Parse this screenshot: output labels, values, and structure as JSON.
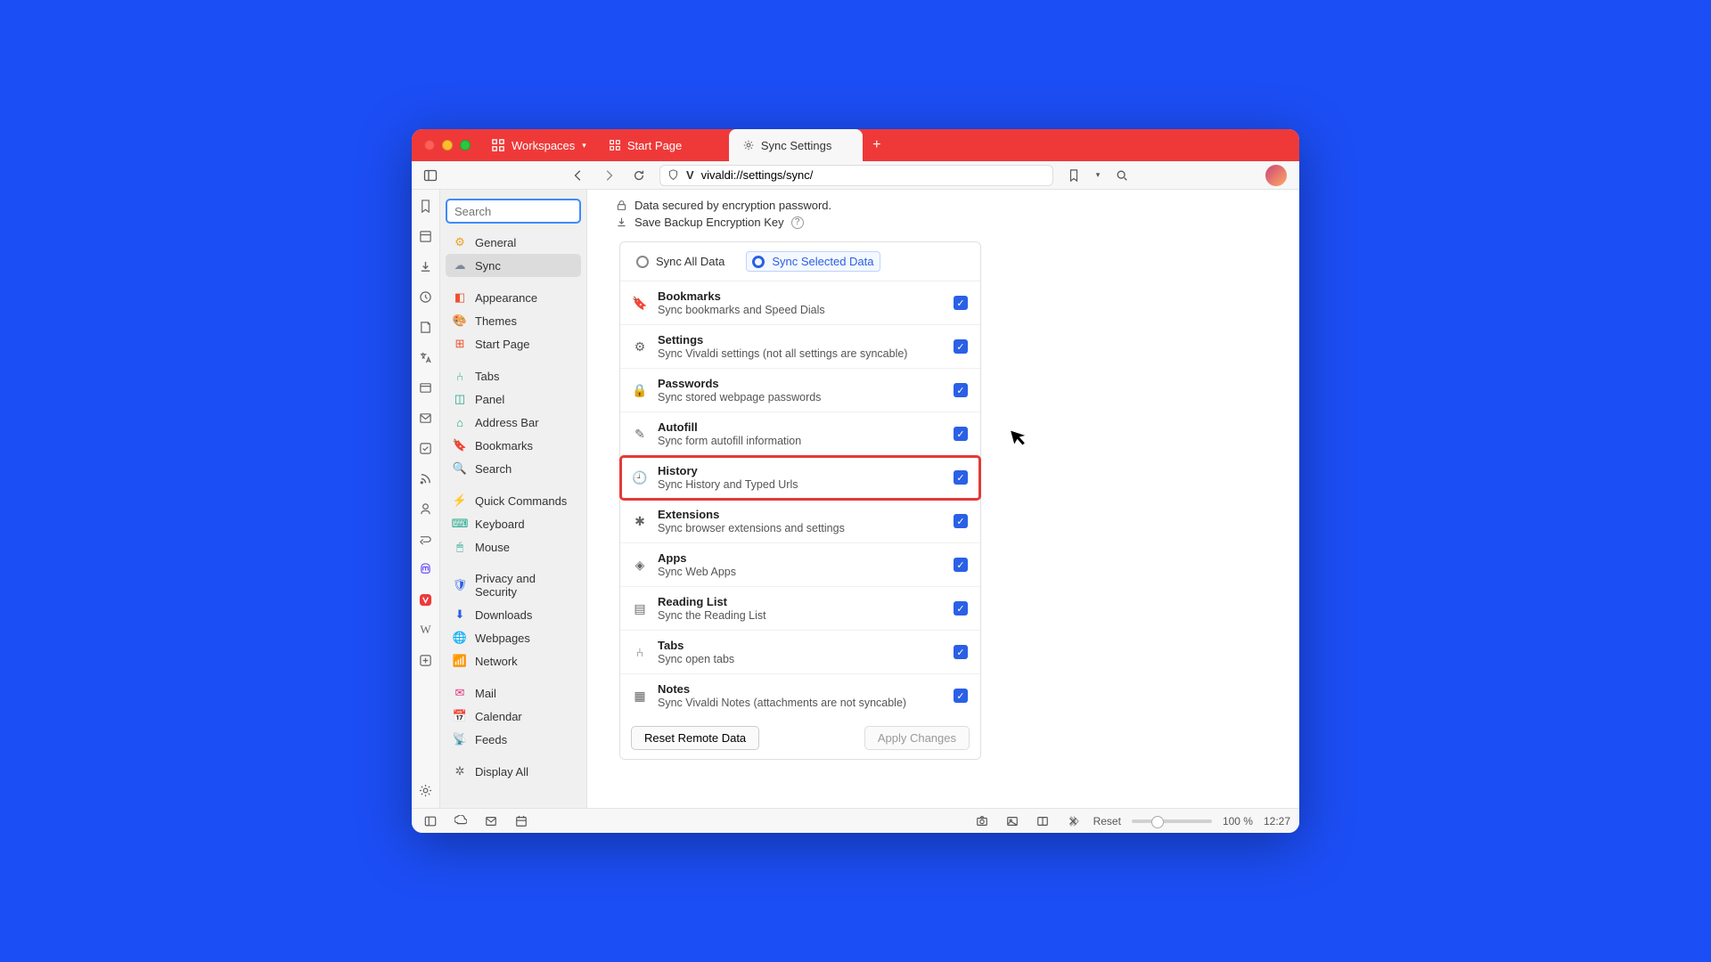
{
  "window": {
    "workspaces_label": "Workspaces",
    "tabs": [
      {
        "label": "Start Page",
        "active": false
      },
      {
        "label": "Sync Settings",
        "active": true
      }
    ]
  },
  "address": {
    "url": "vivaldi://settings/sync/"
  },
  "panel_strip": [
    "bookmarks",
    "reading-list",
    "downloads",
    "history",
    "notes",
    "translate",
    "window",
    "mail",
    "tasks",
    "feeds",
    "contacts",
    "sessions",
    "mastodon",
    "vivaldi",
    "wiki",
    "add"
  ],
  "sidebar": {
    "search_placeholder": "Search",
    "items": [
      {
        "label": "General"
      },
      {
        "label": "Sync"
      },
      {
        "label": "Appearance"
      },
      {
        "label": "Themes"
      },
      {
        "label": "Start Page"
      },
      {
        "label": "Tabs"
      },
      {
        "label": "Panel"
      },
      {
        "label": "Address Bar"
      },
      {
        "label": "Bookmarks"
      },
      {
        "label": "Search"
      },
      {
        "label": "Quick Commands"
      },
      {
        "label": "Keyboard"
      },
      {
        "label": "Mouse"
      },
      {
        "label": "Privacy and Security"
      },
      {
        "label": "Downloads"
      },
      {
        "label": "Webpages"
      },
      {
        "label": "Network"
      },
      {
        "label": "Mail"
      },
      {
        "label": "Calendar"
      },
      {
        "label": "Feeds"
      },
      {
        "label": "Display All"
      }
    ],
    "selected_index": 1,
    "groups_after": [
      1,
      4,
      9,
      12,
      16,
      19
    ]
  },
  "encryption": {
    "line1": "Data secured by encryption password.",
    "line2": "Save Backup Encryption Key"
  },
  "sync": {
    "mode_all": "Sync All Data",
    "mode_selected": "Sync Selected Data",
    "rows": [
      {
        "title": "Bookmarks",
        "sub": "Sync bookmarks and Speed Dials",
        "checked": true,
        "highlight": false,
        "icon": "bookmark-icon"
      },
      {
        "title": "Settings",
        "sub": "Sync Vivaldi settings (not all settings are syncable)",
        "checked": true,
        "highlight": false,
        "icon": "gear-icon"
      },
      {
        "title": "Passwords",
        "sub": "Sync stored webpage passwords",
        "checked": true,
        "highlight": false,
        "icon": "lock-icon"
      },
      {
        "title": "Autofill",
        "sub": "Sync form autofill information",
        "checked": true,
        "highlight": false,
        "icon": "pencil-icon"
      },
      {
        "title": "History",
        "sub": "Sync History and Typed Urls",
        "checked": true,
        "highlight": true,
        "icon": "clock-icon"
      },
      {
        "title": "Extensions",
        "sub": "Sync browser extensions and settings",
        "checked": true,
        "highlight": false,
        "icon": "puzzle-icon"
      },
      {
        "title": "Apps",
        "sub": "Sync Web Apps",
        "checked": true,
        "highlight": false,
        "icon": "apps-icon"
      },
      {
        "title": "Reading List",
        "sub": "Sync the Reading List",
        "checked": true,
        "highlight": false,
        "icon": "list-icon"
      },
      {
        "title": "Tabs",
        "sub": "Sync open tabs",
        "checked": true,
        "highlight": false,
        "icon": "tab-icon"
      },
      {
        "title": "Notes",
        "sub": "Sync Vivaldi Notes (attachments are not syncable)",
        "checked": true,
        "highlight": false,
        "icon": "note-icon"
      }
    ],
    "reset_label": "Reset Remote Data",
    "apply_label": "Apply Changes"
  },
  "status": {
    "reset": "Reset",
    "zoom": "100 %",
    "clock": "12:27"
  },
  "nav_icons": {
    "General": {
      "glyph": "⚙",
      "color": "#f0a020"
    },
    "Sync": {
      "glyph": "☁",
      "color": "#7a8a9a"
    },
    "Appearance": {
      "glyph": "◧",
      "color": "#f05030"
    },
    "Themes": {
      "glyph": "🎨",
      "color": "#9a6a40"
    },
    "Start Page": {
      "glyph": "⊞",
      "color": "#f05030"
    },
    "Tabs": {
      "glyph": "⑃",
      "color": "#20a98a"
    },
    "Panel": {
      "glyph": "◫",
      "color": "#20a98a"
    },
    "Address Bar": {
      "glyph": "⌂",
      "color": "#20a98a"
    },
    "Bookmarks": {
      "glyph": "🔖",
      "color": "#20a98a"
    },
    "Search": {
      "glyph": "🔍",
      "color": "#20a98a"
    },
    "Quick Commands": {
      "glyph": "⚡",
      "color": "#20a98a"
    },
    "Keyboard": {
      "glyph": "⌨",
      "color": "#20a98a"
    },
    "Mouse": {
      "glyph": "🖱",
      "color": "#20a98a"
    },
    "Privacy and Security": {
      "glyph": "🛡",
      "color": "#2a60e5"
    },
    "Downloads": {
      "glyph": "⬇",
      "color": "#2a60e5"
    },
    "Webpages": {
      "glyph": "🌐",
      "color": "#2a60e5"
    },
    "Network": {
      "glyph": "📶",
      "color": "#2a60e5"
    },
    "Mail": {
      "glyph": "✉",
      "color": "#e53078"
    },
    "Calendar": {
      "glyph": "📅",
      "color": "#e53078"
    },
    "Feeds": {
      "glyph": "📡",
      "color": "#e53078"
    },
    "Display All": {
      "glyph": "✲",
      "color": "#666"
    }
  },
  "row_icons": {
    "bookmark-icon": "🔖",
    "gear-icon": "⚙",
    "lock-icon": "🔒",
    "pencil-icon": "✎",
    "clock-icon": "🕘",
    "puzzle-icon": "✱",
    "apps-icon": "◈",
    "list-icon": "▤",
    "tab-icon": "⑃",
    "note-icon": "▦"
  }
}
